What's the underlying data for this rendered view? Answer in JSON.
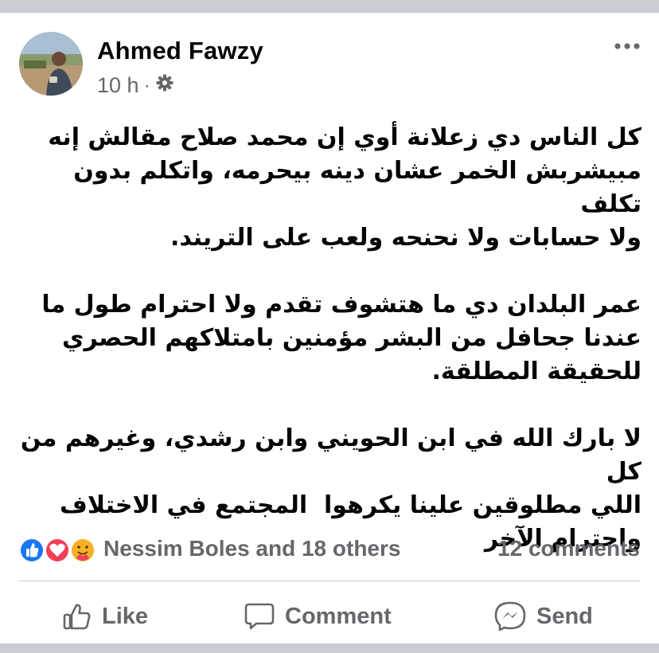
{
  "post": {
    "author": "Ahmed Fawzy",
    "time": "10 h",
    "separator": "·",
    "privacy_icon": "gear-icon",
    "more_icon": "more-dots-icon",
    "body": "كل الناس دي زعلانة أوي إن محمد صلاح مقالش إنه\nمبيشربش الخمر عشان دينه بيحرمه، واتكلم بدون تكلف\nولا حسابات ولا نحنحه ولعب على التريند.\n\nعمر البلدان دي ما هتشوف تقدم ولا احترام طول ما\nعندنا جحافل من البشر مؤمنين بامتلاكهم الحصري\nللحقيقة المطلقة.\n\nلا بارك الله في ابن الحويني وابن رشدي، وغيرهم من كل\nاللي مطلوقين علينا يكرهوا  المجتمع في الاختلاف\nواحترام الآخر"
  },
  "reactions": {
    "icons": [
      "like-reaction-icon",
      "love-reaction-icon",
      "care-reaction-icon"
    ],
    "summary": "Nessim Boles and 18 others",
    "comments": "12 comments"
  },
  "actions": {
    "like": "Like",
    "comment": "Comment",
    "send": "Send"
  },
  "colors": {
    "text": "#050505",
    "secondary": "#65676b",
    "like_blue": "#1877f2",
    "love_red": "#f33e58",
    "care_yellow": "#f7b125",
    "divider": "#ced0d4"
  }
}
